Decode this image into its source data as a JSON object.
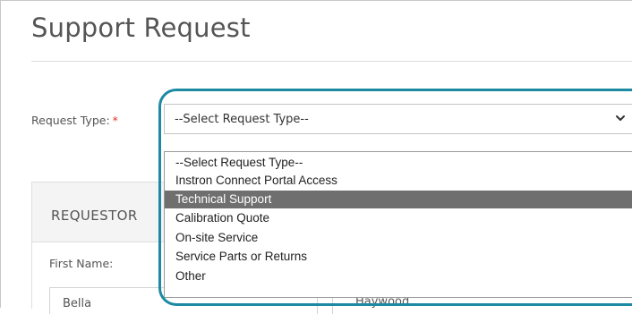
{
  "page": {
    "title": "Support Request"
  },
  "request_type": {
    "label": "Request Type:",
    "required_marker": "*",
    "selected_value": "--Select Request Type--",
    "options": [
      "--Select Request Type--",
      "Instron Connect Portal Access",
      "Technical Support",
      "Calibration Quote",
      "On-site Service",
      "Service Parts or Returns",
      "Other"
    ],
    "highlighted_option": "Technical Support"
  },
  "requestor_section": {
    "title": "REQUESTOR",
    "first_name_label": "First Name:",
    "first_name_value": "Bella",
    "last_name_value": "Haywood"
  },
  "colors": {
    "highlight_ring": "#1d8aa3",
    "selected_option_bg": "#6f6f6f",
    "required_star": "#d9342b"
  },
  "icons": {
    "select_caret": "chevron-down-icon"
  }
}
